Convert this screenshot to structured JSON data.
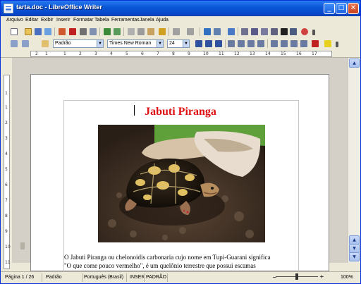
{
  "window": {
    "title": "tarta.doc - LibreOffice Writer"
  },
  "titlebar_buttons": {
    "minimize": "_",
    "maximize": "□",
    "close": "✕"
  },
  "menu": [
    "Arquivo",
    "Editar",
    "Exibir",
    "Inserir",
    "Formatar",
    "Tabela",
    "Ferramentas",
    "Janela",
    "Ajuda"
  ],
  "formatting": {
    "style": "Padrão",
    "font": "Times New Roman",
    "size": "24"
  },
  "ruler": {
    "marks": [
      "2",
      "1",
      "1",
      "2",
      "3",
      "4",
      "5",
      "6",
      "7",
      "8",
      "9",
      "10",
      "11",
      "12",
      "13",
      "14",
      "15",
      "16",
      "17"
    ]
  },
  "vruler": {
    "marks": [
      "1",
      "1",
      "2",
      "3",
      "4",
      "5",
      "6",
      "7",
      "8",
      "9",
      "10",
      "11"
    ]
  },
  "document": {
    "title": "Jabuti Piranga",
    "paragraph_line1": "O Jabuti Piranga ou chelonoidis carbonaria cujo nome em Tupi-Guarani significa",
    "paragraph_line2": "\"O que come pouco vermelho\", é um quelônio terrestre que possui escamas"
  },
  "status": {
    "page": "Página 1 / 26",
    "style": "Padrão",
    "language": "Português (Brasil)",
    "insert": "INSER",
    "selection": "PADRÃO",
    "zoom": "100%"
  },
  "colors": {
    "title": "#e01010",
    "titlebar": "#0a58d8"
  }
}
